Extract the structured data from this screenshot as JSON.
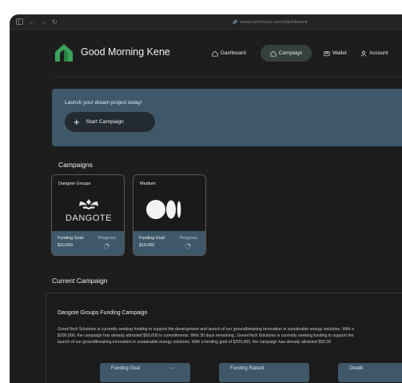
{
  "browser": {
    "url": "www.luminous.com/dashboard"
  },
  "header": {
    "greeting": "Good Morning Kene",
    "nav": [
      {
        "label": "Dashboard",
        "icon": "home-icon"
      },
      {
        "label": "Campaign",
        "icon": "home-icon",
        "active": true
      },
      {
        "label": "Wallet",
        "icon": "wallet-icon"
      },
      {
        "label": "Account",
        "icon": "user-icon"
      }
    ]
  },
  "banner": {
    "text": "Launch your dream project today!",
    "button_label": "Start Campaign"
  },
  "campaigns": {
    "title": "Campaigns",
    "items": [
      {
        "name": "Dangote Groups",
        "logo_text": "DANGOTE",
        "goal_label": "Funding Goal:",
        "goal_value": "$10,000",
        "progress_label": "Progress:"
      },
      {
        "name": "Medium",
        "goal_label": "Funding Goal:",
        "goal_value": "$19,000",
        "progress_label": "Progress:"
      }
    ]
  },
  "current": {
    "title": "Current Campaign",
    "panel_title": "Dangote Groups Funding Campaign",
    "description": [
      "GreenTech Solutions is currently seeking funding to support the development and launch of our groundbreaking innovation in sustainable energy solutions. With a",
      "$200,000, the campaign has already attracted $50,000 in commitments. With 30 days remaining...GreenTech Solutions is currently seeking funding to support the",
      "launch of our groundbreaking innovation in sustainable energy solutions. With a funding goal of $200,000, the campaign has already attracted $50,00"
    ],
    "stats": [
      "Funding Goal",
      "Funding Raised",
      "Deadli"
    ]
  },
  "colors": {
    "accent": "#3f5869",
    "background": "#1d1d1d",
    "logo": "#3aa35a"
  }
}
